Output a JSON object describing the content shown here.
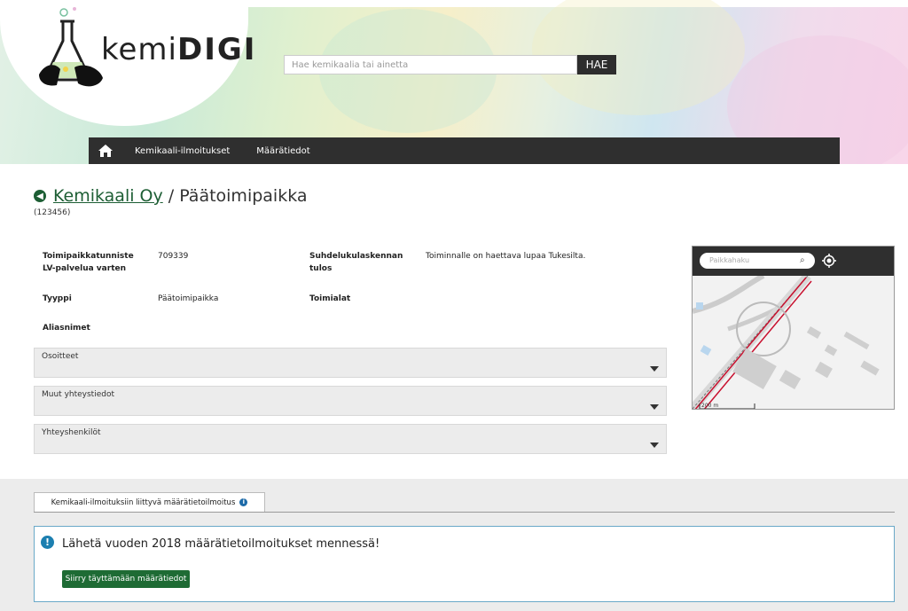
{
  "brand": {
    "logo_text_light": "kemi",
    "logo_text_bold": "DIGI"
  },
  "search": {
    "placeholder": "Hae kemikaalia tai ainetta",
    "button_label": "HAE"
  },
  "nav": {
    "items": [
      {
        "label": "Kemikaali-ilmoitukset"
      },
      {
        "label": "Määrätiedot"
      }
    ]
  },
  "title": {
    "link_text": "Kemikaali Oy",
    "rest_text": "/ Päätoimipaikka",
    "subid": "(123456)"
  },
  "details": {
    "toimipaikka_label_1": "Toimipaikkatunniste",
    "toimipaikka_label_2": "LV-palvelua varten",
    "toimipaikka_value": "709339",
    "suhdeluku_label_1": "Suhdelukulaskennan",
    "suhdeluku_label_2": "tulos",
    "suhdeluku_value": "Toiminnalle on haettava lupaa Tukesilta.",
    "tyyppi_label": "Tyyppi",
    "tyyppi_value": "Päätoimipaikka",
    "toimialat_label": "Toimialat",
    "aliasnimet_label": "Aliasnimet"
  },
  "accordions": [
    {
      "label": "Osoitteet"
    },
    {
      "label": "Muut yhteystiedot"
    },
    {
      "label": "Yhteyshenkilöt"
    }
  ],
  "map": {
    "search_placeholder": "Paikkahaku",
    "scale_label": "200 m"
  },
  "tab": {
    "label": "Kemikaali-ilmoituksiin liittyvä määrätietoilmoitus"
  },
  "notice": {
    "text": "Lähetä vuoden 2018 määrätietoilmoitukset mennessä!",
    "button_label": "Siirry täyttämään määrätiedot"
  },
  "colors": {
    "nav_bg": "#2f2f2f",
    "accent_green": "#1e6b34",
    "info_blue": "#1c7fb0"
  }
}
